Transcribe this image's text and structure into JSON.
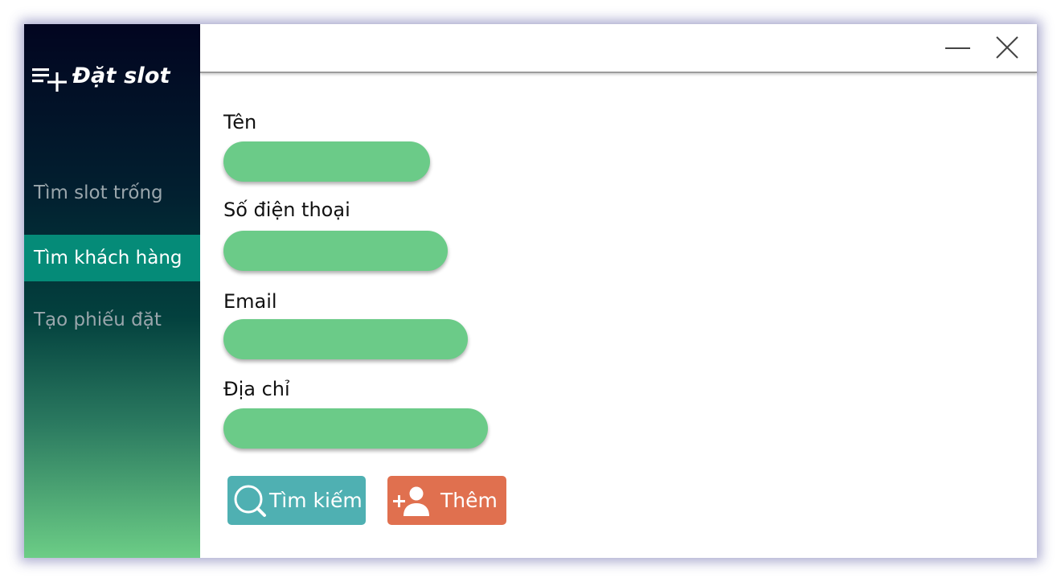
{
  "app": {
    "title": "Đặt slot",
    "icon": "playlist-add-icon"
  },
  "sidebar": {
    "items": [
      {
        "label": "Tìm slot trống",
        "active": false
      },
      {
        "label": "Tìm khách hàng",
        "active": true
      },
      {
        "label": "Tạo phiếu đặt",
        "active": false
      }
    ]
  },
  "window_controls": {
    "minimize_icon": "minimize-icon",
    "close_icon": "close-icon"
  },
  "form": {
    "name": {
      "label": "Tên",
      "value": ""
    },
    "phone": {
      "label": "Số điện thoại",
      "value": ""
    },
    "email": {
      "label": "Email",
      "value": ""
    },
    "address": {
      "label": "Địa chỉ",
      "value": ""
    }
  },
  "actions": {
    "search": {
      "label": "Tìm kiếm",
      "icon": "search-icon"
    },
    "add": {
      "label": "Thêm",
      "icon": "add-user-icon"
    }
  },
  "colors": {
    "sidebar_top": "#020520",
    "sidebar_bottom": "#6ccd86",
    "nav_active": "#058b78",
    "input_fill": "#6bcb88",
    "search_button": "#4fb0b2",
    "add_button": "#e0704f"
  }
}
